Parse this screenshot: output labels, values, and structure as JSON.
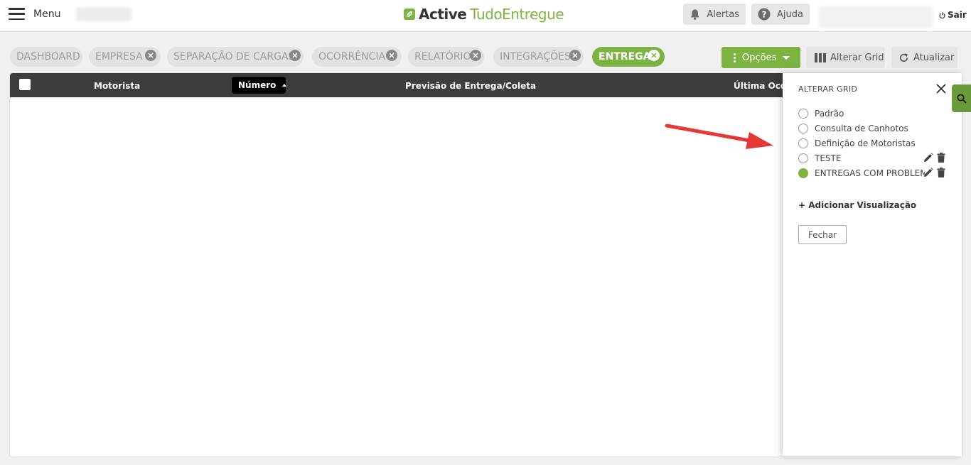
{
  "header": {
    "menu_label": "Menu",
    "logo_bold": "Active",
    "logo_brand": "TudoEntregue",
    "alerts_label": "Alertas",
    "help_label": "Ajuda",
    "logout_label": "Sair"
  },
  "tabs": [
    {
      "label": "DASHBOARD",
      "closable": false,
      "active": false
    },
    {
      "label": "EMPRESA",
      "closable": true,
      "active": false
    },
    {
      "label": "SEPARAÇÃO DE CARGAS",
      "closable": true,
      "active": false
    },
    {
      "label": "OCORRÊNCIA",
      "closable": true,
      "active": false
    },
    {
      "label": "RELATÓRIO",
      "closable": true,
      "active": false
    },
    {
      "label": "INTEGRAÇÕES",
      "closable": true,
      "active": false
    },
    {
      "label": "ENTREGA",
      "closable": true,
      "active": true
    }
  ],
  "toolbar": {
    "options_label": "Opções",
    "alter_grid_label": "Alterar Grid",
    "refresh_label": "Atualizar"
  },
  "grid": {
    "columns": {
      "motorista": "Motorista",
      "numero": "Número",
      "previsao": "Previsão de Entrega/Coleta",
      "ultima": "Última Ocorr"
    },
    "sorted_column": "Número",
    "sort_direction": "asc"
  },
  "panel": {
    "title": "ALTERAR GRID",
    "options": [
      {
        "label": "Padrão",
        "selected": false,
        "editable": false
      },
      {
        "label": "Consulta de Canhotos",
        "selected": false,
        "editable": false
      },
      {
        "label": "Definição de Motoristas",
        "selected": false,
        "editable": false
      },
      {
        "label": "TESTE",
        "selected": false,
        "editable": true
      },
      {
        "label": "ENTREGAS COM PROBLEMAS",
        "selected": true,
        "editable": true
      }
    ],
    "add_view_label": "+ Adicionar Visualização",
    "close_label": "Fechar"
  },
  "colors": {
    "brand_green": "#7cb342",
    "header_dark": "#3d3d3d",
    "annotation_arrow": "#e53935"
  }
}
